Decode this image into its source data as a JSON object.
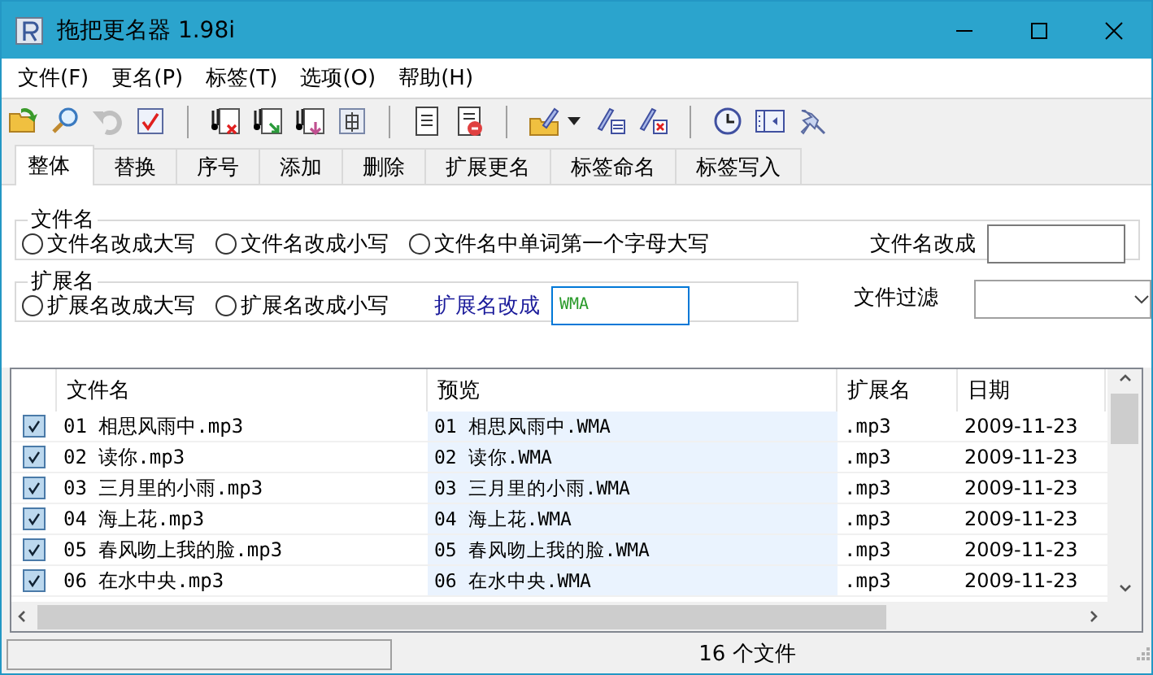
{
  "window": {
    "title": "拖把更名器 1.98i"
  },
  "menu": [
    "文件(F)",
    "更名(P)",
    "标签(T)",
    "选项(O)",
    "帮助(H)"
  ],
  "toolbar": [
    {
      "kind": "open",
      "disabled": false
    },
    {
      "kind": "search",
      "disabled": false
    },
    {
      "kind": "undo",
      "disabled": true
    },
    {
      "kind": "check",
      "disabled": false
    },
    {
      "kind": "separator"
    },
    {
      "kind": "tag-delete",
      "disabled": false
    },
    {
      "kind": "tag-import",
      "disabled": false
    },
    {
      "kind": "tag-export",
      "disabled": false
    },
    {
      "kind": "simplify",
      "disabled": false
    },
    {
      "kind": "separator"
    },
    {
      "kind": "list",
      "disabled": false
    },
    {
      "kind": "doc-remove",
      "disabled": false
    },
    {
      "kind": "separator"
    },
    {
      "kind": "pen-folder",
      "disabled": false
    },
    {
      "kind": "caret",
      "disabled": false
    },
    {
      "kind": "pen-list",
      "disabled": false
    },
    {
      "kind": "pen-delete",
      "disabled": false
    },
    {
      "kind": "separator"
    },
    {
      "kind": "clock",
      "disabled": false
    },
    {
      "kind": "panel",
      "disabled": false
    },
    {
      "kind": "pin",
      "disabled": false
    }
  ],
  "tabs": [
    {
      "label": "整体",
      "selected": true
    },
    {
      "label": "替换",
      "selected": false
    },
    {
      "label": "序号",
      "selected": false
    },
    {
      "label": "添加",
      "selected": false
    },
    {
      "label": "删除",
      "selected": false
    },
    {
      "label": "扩展更名",
      "selected": false
    },
    {
      "label": "标签命名",
      "selected": false
    },
    {
      "label": "标签写入",
      "selected": false
    }
  ],
  "filename_group": {
    "title": "文件名",
    "options": [
      {
        "label": "文件名改成大写",
        "selected": false
      },
      {
        "label": "文件名改成小写",
        "selected": false
      },
      {
        "label": "文件名中单词第一个字母大写",
        "selected": false
      }
    ],
    "rename_label": "文件名改成"
  },
  "extension_group": {
    "title": "扩展名",
    "options": [
      {
        "label": "扩展名改成大写",
        "selected": false
      },
      {
        "label": "扩展名改成小写",
        "selected": false
      }
    ],
    "rename_label": "扩展名改成",
    "rename_value": "WMA"
  },
  "filter": {
    "label": "文件过滤"
  },
  "table": {
    "columns": [
      "文件名",
      "预览",
      "扩展名",
      "日期"
    ],
    "rows": [
      {
        "checked": true,
        "filename": "01 相思风雨中.mp3",
        "preview": "01 相思风雨中.WMA",
        "extension": ".mp3",
        "date": "2009-11-23"
      },
      {
        "checked": true,
        "filename": "02 读你.mp3",
        "preview": "02 读你.WMA",
        "extension": ".mp3",
        "date": "2009-11-23"
      },
      {
        "checked": true,
        "filename": "03 三月里的小雨.mp3",
        "preview": "03 三月里的小雨.WMA",
        "extension": ".mp3",
        "date": "2009-11-23"
      },
      {
        "checked": true,
        "filename": "04 海上花.mp3",
        "preview": "04 海上花.WMA",
        "extension": ".mp3",
        "date": "2009-11-23"
      },
      {
        "checked": true,
        "filename": "05 春风吻上我的脸.mp3",
        "preview": "05 春风吻上我的脸.WMA",
        "extension": ".mp3",
        "date": "2009-11-23"
      },
      {
        "checked": true,
        "filename": "06 在水中央.mp3",
        "preview": "06 在水中央.WMA",
        "extension": ".mp3",
        "date": "2009-11-23"
      }
    ]
  },
  "status_bar": {
    "count": "16 个文件"
  }
}
